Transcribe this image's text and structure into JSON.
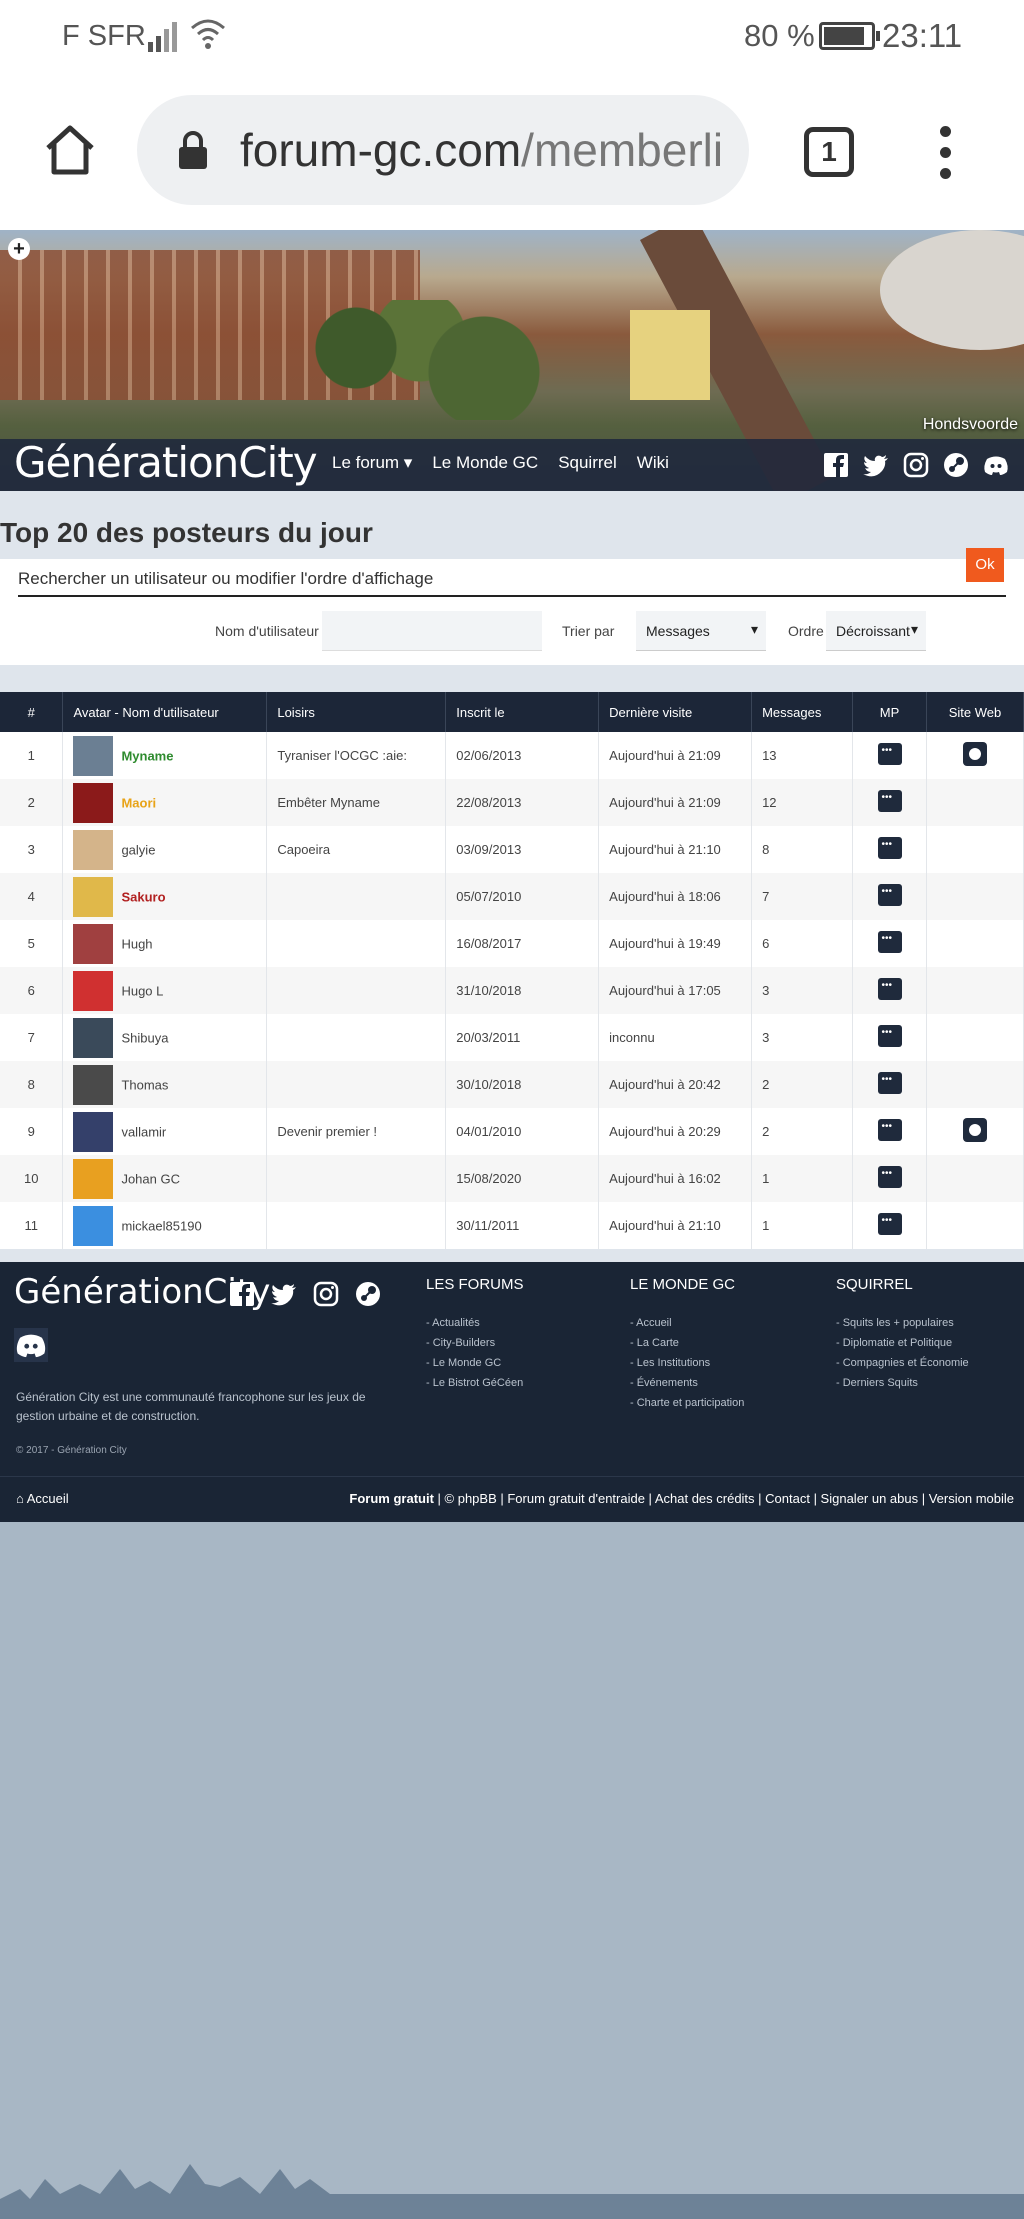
{
  "status": {
    "carrier": "F SFR",
    "battery": "80 %",
    "time": "23:11"
  },
  "browser": {
    "url_host": "forum-gc.com",
    "url_path": "/memberli",
    "tabs": "1"
  },
  "banner": {
    "place": "Hondsvoorde",
    "logo": "GénérationCity"
  },
  "nav": {
    "items": [
      "Le forum ▾",
      "Le Monde GC",
      "Squirrel",
      "Wiki"
    ]
  },
  "page": {
    "title": "Top 20 des posteurs du jour"
  },
  "search": {
    "heading": "Rechercher un utilisateur ou modifier l'ordre d'affichage",
    "user_label": "Nom d'utilisateur",
    "sort_label": "Trier par",
    "sort_value": "Messages",
    "order_label": "Ordre",
    "order_value": "Décroissant",
    "ok": "Ok"
  },
  "table": {
    "headers": [
      "#",
      "Avatar - Nom d'utilisateur",
      "Loisirs",
      "Inscrit le",
      "Dernière visite",
      "Messages",
      "MP",
      "Site Web"
    ],
    "rows": [
      {
        "rank": "1",
        "name": "Myname",
        "color": "#2e8b2e",
        "bold": true,
        "hobby": "Tyraniser l'OCGC :aie:",
        "joined": "02/06/2013",
        "last": "Aujourd'hui à 21:09",
        "posts": "13",
        "web": true,
        "avatar": "#6b7f93"
      },
      {
        "rank": "2",
        "name": "Maori",
        "color": "#e8a317",
        "bold": true,
        "hobby": "Embêter Myname",
        "joined": "22/08/2013",
        "last": "Aujourd'hui à 21:09",
        "posts": "12",
        "web": false,
        "avatar": "#8b1a1a"
      },
      {
        "rank": "3",
        "name": "galyie",
        "color": "#444444",
        "bold": false,
        "hobby": "Capoeira",
        "joined": "03/09/2013",
        "last": "Aujourd'hui à 21:10",
        "posts": "8",
        "web": false,
        "avatar": "#d4b48a"
      },
      {
        "rank": "4",
        "name": "Sakuro",
        "color": "#b22222",
        "bold": true,
        "hobby": "",
        "joined": "05/07/2010",
        "last": "Aujourd'hui à 18:06",
        "posts": "7",
        "web": false,
        "avatar": "#e0b84a"
      },
      {
        "rank": "5",
        "name": "Hugh",
        "color": "#444444",
        "bold": false,
        "hobby": "",
        "joined": "16/08/2017",
        "last": "Aujourd'hui à 19:49",
        "posts": "6",
        "web": false,
        "avatar": "#a04040"
      },
      {
        "rank": "6",
        "name": "Hugo L",
        "color": "#444444",
        "bold": false,
        "hobby": "",
        "joined": "31/10/2018",
        "last": "Aujourd'hui à 17:05",
        "posts": "3",
        "web": false,
        "avatar": "#d03030"
      },
      {
        "rank": "7",
        "name": "Shibuya",
        "color": "#444444",
        "bold": false,
        "hobby": "",
        "joined": "20/03/2011",
        "last": "inconnu",
        "posts": "3",
        "web": false,
        "avatar": "#3a4a5a"
      },
      {
        "rank": "8",
        "name": "Thomas",
        "color": "#444444",
        "bold": false,
        "hobby": "",
        "joined": "30/10/2018",
        "last": "Aujourd'hui à 20:42",
        "posts": "2",
        "web": false,
        "avatar": "#4a4a4a"
      },
      {
        "rank": "9",
        "name": "vallamir",
        "color": "#444444",
        "bold": false,
        "hobby": "Devenir premier !",
        "joined": "04/01/2010",
        "last": "Aujourd'hui à 20:29",
        "posts": "2",
        "web": true,
        "avatar": "#34406a"
      },
      {
        "rank": "10",
        "name": "Johan GC",
        "color": "#444444",
        "bold": false,
        "hobby": "",
        "joined": "15/08/2020",
        "last": "Aujourd'hui à 16:02",
        "posts": "1",
        "web": false,
        "avatar": "#e8a020"
      },
      {
        "rank": "11",
        "name": "mickael85190",
        "color": "#444444",
        "bold": false,
        "hobby": "",
        "joined": "30/11/2011",
        "last": "Aujourd'hui à 21:10",
        "posts": "1",
        "web": false,
        "avatar": "#3b8fe0"
      }
    ]
  },
  "footer": {
    "logo": "GénérationCity",
    "description": "Génération City est une communauté francophone sur les jeux de gestion urbaine et de construction.",
    "copyright": "© 2017 - Génération City",
    "col1": {
      "title": "LES FORUMS",
      "items": [
        "- Actualités",
        "- City-Builders",
        "- Le Monde GC",
        "- Le Bistrot GéCéen"
      ]
    },
    "col2": {
      "title": "LE MONDE GC",
      "items": [
        "- Accueil",
        "- La Carte",
        "- Les Institutions",
        "- Événements",
        "- Charte et participation"
      ]
    },
    "col3": {
      "title": "SQUIRREL",
      "items": [
        "- Squits les + populaires",
        "- Diplomatie et Politique",
        "- Compagnies et Économie",
        "- Derniers Squits"
      ]
    },
    "home": "Accueil",
    "bottom_bold": "Forum gratuit",
    "bottom_links": " | © phpBB | Forum gratuit d'entraide | Achat des crédits | Contact | Signaler un abus | Version mobile"
  }
}
